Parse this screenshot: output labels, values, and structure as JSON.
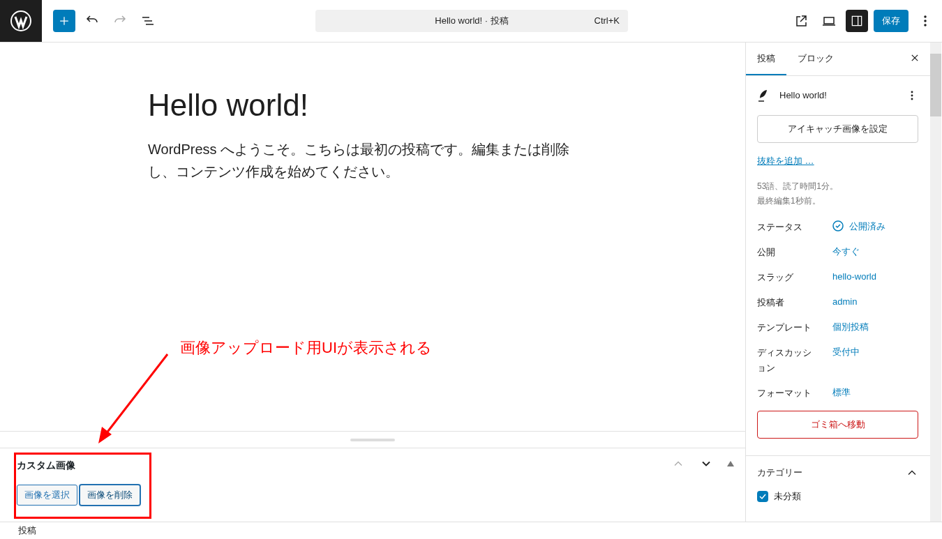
{
  "toolbar": {
    "command_bar": {
      "title": "Hello world! · 投稿",
      "shortcut": "Ctrl+K"
    },
    "save_button": "保存",
    "settings_panel_open": true
  },
  "editor": {
    "title": "Hello world!",
    "paragraph": "WordPress へようこそ。こちらは最初の投稿です。編集または削除し、コンテンツ作成を始めてください。"
  },
  "meta_box": {
    "title": "カスタム画像",
    "buttons": [
      {
        "label": "画像を選択",
        "focused": false
      },
      {
        "label": "画像を削除",
        "focused": true
      }
    ]
  },
  "annotation": {
    "text": "画像アップロード用UIが表示される"
  },
  "sidebar": {
    "tabs": [
      {
        "label": "投稿",
        "selected": true
      },
      {
        "label": "ブロック",
        "selected": false
      }
    ],
    "post_title": "Hello world!",
    "featured_image_button": "アイキャッチ画像を設定",
    "excerpt_link": "抜粋を追加 …",
    "stats": [
      "53語、読了時間1分。",
      "最終編集1秒前。"
    ],
    "fields": [
      {
        "label": "ステータス",
        "value": "公開済み",
        "kind": "status"
      },
      {
        "label": "公開",
        "value": "今すぐ",
        "kind": "link"
      },
      {
        "label": "スラッグ",
        "value": "hello-world",
        "kind": "link"
      },
      {
        "label": "投稿者",
        "value": "admin",
        "kind": "link"
      },
      {
        "label": "テンプレート",
        "value": "個別投稿",
        "kind": "link"
      },
      {
        "label": "ディスカッション",
        "value": "受付中",
        "kind": "link"
      },
      {
        "label": "フォーマット",
        "value": "標準",
        "kind": "link"
      }
    ],
    "trash_button": "ゴミ箱へ移動",
    "categories": {
      "title": "カテゴリー",
      "expanded": true,
      "items": [
        {
          "label": "未分類",
          "checked": true
        }
      ]
    }
  },
  "status_bar": "投稿"
}
